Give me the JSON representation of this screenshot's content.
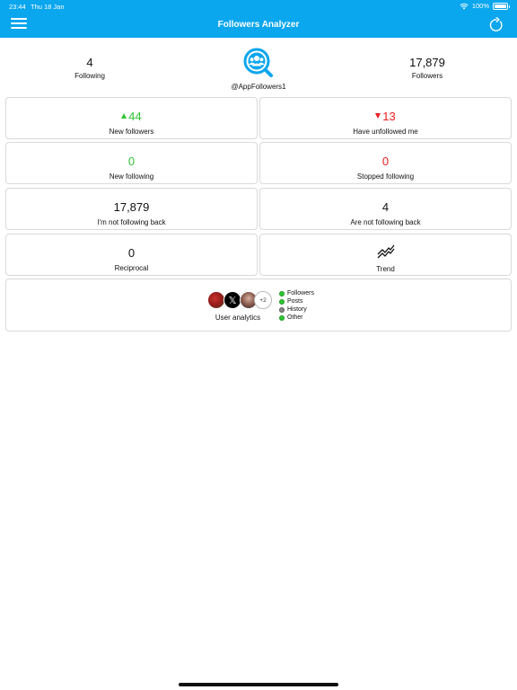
{
  "status_bar": {
    "time": "23:44",
    "date": "Thu 18 Jan",
    "battery": "100%",
    "battery_level": 1.0
  },
  "header": {
    "title": "Followers Analyzer",
    "menu_icon": "hamburger-menu-icon",
    "refresh_icon": "refresh-icon"
  },
  "profile": {
    "following_count": "4",
    "following_label": "Following",
    "followers_count": "17,879",
    "followers_label": "Followers",
    "handle": "@AppFollowers1",
    "logo_icon": "followers-search-logo"
  },
  "cards": {
    "new_followers": {
      "value": "44",
      "label": "New followers",
      "trend": "up"
    },
    "unfollowed": {
      "value": "13",
      "label": "Have unfollowed me",
      "trend": "down"
    },
    "new_following": {
      "value": "0",
      "label": "New following"
    },
    "stopped_following": {
      "value": "0",
      "label": "Stopped following"
    },
    "not_following_back": {
      "value": "17,879",
      "label": "I'm not following back"
    },
    "are_not_following_back": {
      "value": "4",
      "label": "Are not following back"
    },
    "reciprocal": {
      "value": "0",
      "label": "Reciprocal"
    },
    "trend": {
      "label": "Trend",
      "icon": "trend-chart-icon"
    }
  },
  "analytics": {
    "label": "User analytics",
    "more_count": "+2",
    "legend": [
      {
        "label": "Followers",
        "color": "#2fc535"
      },
      {
        "label": "Posts",
        "color": "#2fc535"
      },
      {
        "label": "History",
        "color": "#8a8a8a"
      },
      {
        "label": "Other",
        "color": "#2fc535"
      }
    ]
  },
  "colors": {
    "header": "#0aa6ee",
    "positive": "#2fc535",
    "negative": "#e81d1d"
  }
}
